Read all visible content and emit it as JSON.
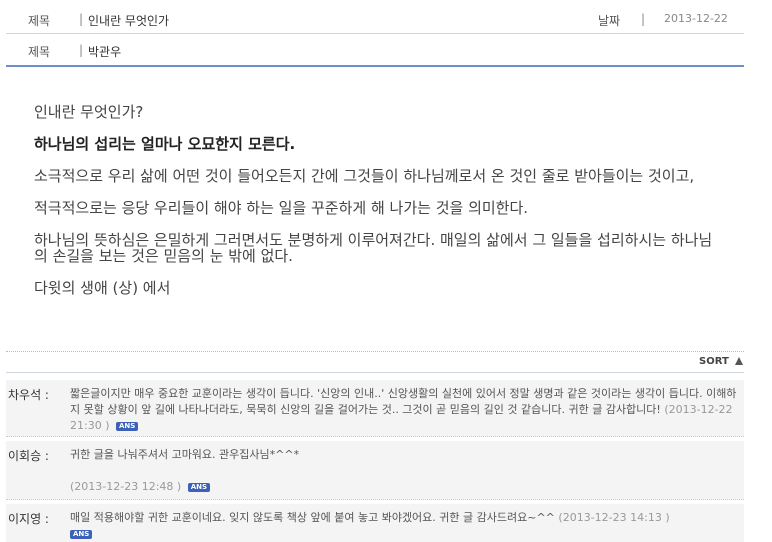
{
  "header": {
    "subject_label": "제목",
    "subject_value": "인내란 무엇인가",
    "date_label": "날짜",
    "date_value": "2013-12-22",
    "author_label": "제목",
    "author_value": "박관우",
    "separator": "|"
  },
  "content": {
    "paragraphs": [
      "인내란 무엇인가?",
      "하나님의 섭리는 얼마나 오묘한지 모른다.",
      "소극적으로 우리 삶에 어떤 것이 들어오든지 간에 그것들이 하나님께로서 온 것인 줄로 받아들이는 것이고,",
      "적극적으로는 응당 우리들이 해야 하는 일을 꾸준하게 해 나가는 것을 의미한다.",
      "하나님의 뜻하심은 은밀하게 그러면서도 분명하게 이루어져간다. 매일의 삶에서 그 일들을 섭리하시는 하나님의 손길을 보는 것은 믿음의 눈 밖에 없다.",
      "다윗의 생애 (상) 에서"
    ]
  },
  "comments": {
    "sort_label": "SORT",
    "answer_badge": "ANS",
    "items": [
      {
        "author": "차우석 :",
        "text": "짧은글이지만 매우 중요한 교훈이라는 생각이 듭니다. '신앙의 인내..' 신앙생활의 실천에 있어서 정말 생명과 같은 것이라는 생각이 듭니다. 이해하지 못할 상황이 앞 길에 나타나더라도, 묵묵히 신앙의 길을 걸어가는 것.. 그것이 곧 믿음의 길인 것 같습니다. 귀한 글 감사합니다!",
        "timestamp": "(2013-12-22 21:30 )"
      },
      {
        "author": "이회승 :",
        "text": "귀한 글을 나눠주셔서 고마워요. 관우집사님*^^*",
        "timestamp": "(2013-12-23 12:48 )"
      },
      {
        "author": "이지영 :",
        "text": "매일 적용해야할 귀한 교훈이네요. 잊지 않도록 책상 앞에 붙여 놓고 봐야겠어요. 귀한 글 감사드려요~^^",
        "timestamp": "(2013-12-23 14:13 )"
      }
    ]
  }
}
